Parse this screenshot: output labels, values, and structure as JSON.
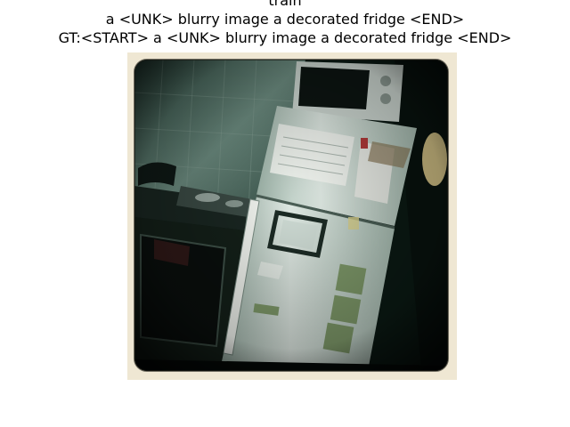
{
  "figure": {
    "title": "train",
    "prediction": "a <UNK> blurry image a decorated fridge <END>",
    "ground_truth": "GT:<START> a <UNK> blurry image a decorated fridge <END>"
  },
  "photo": {
    "subject": "kitchen-with-fridge",
    "colors": {
      "frame": "#efe7d3",
      "shadow_tone": "#0b1a14",
      "wall_tone": "#6e8e82",
      "fridge_tone": "#dfe9e3",
      "highlight": "#f3f6f1",
      "warm_light": "#f4df9a"
    }
  }
}
